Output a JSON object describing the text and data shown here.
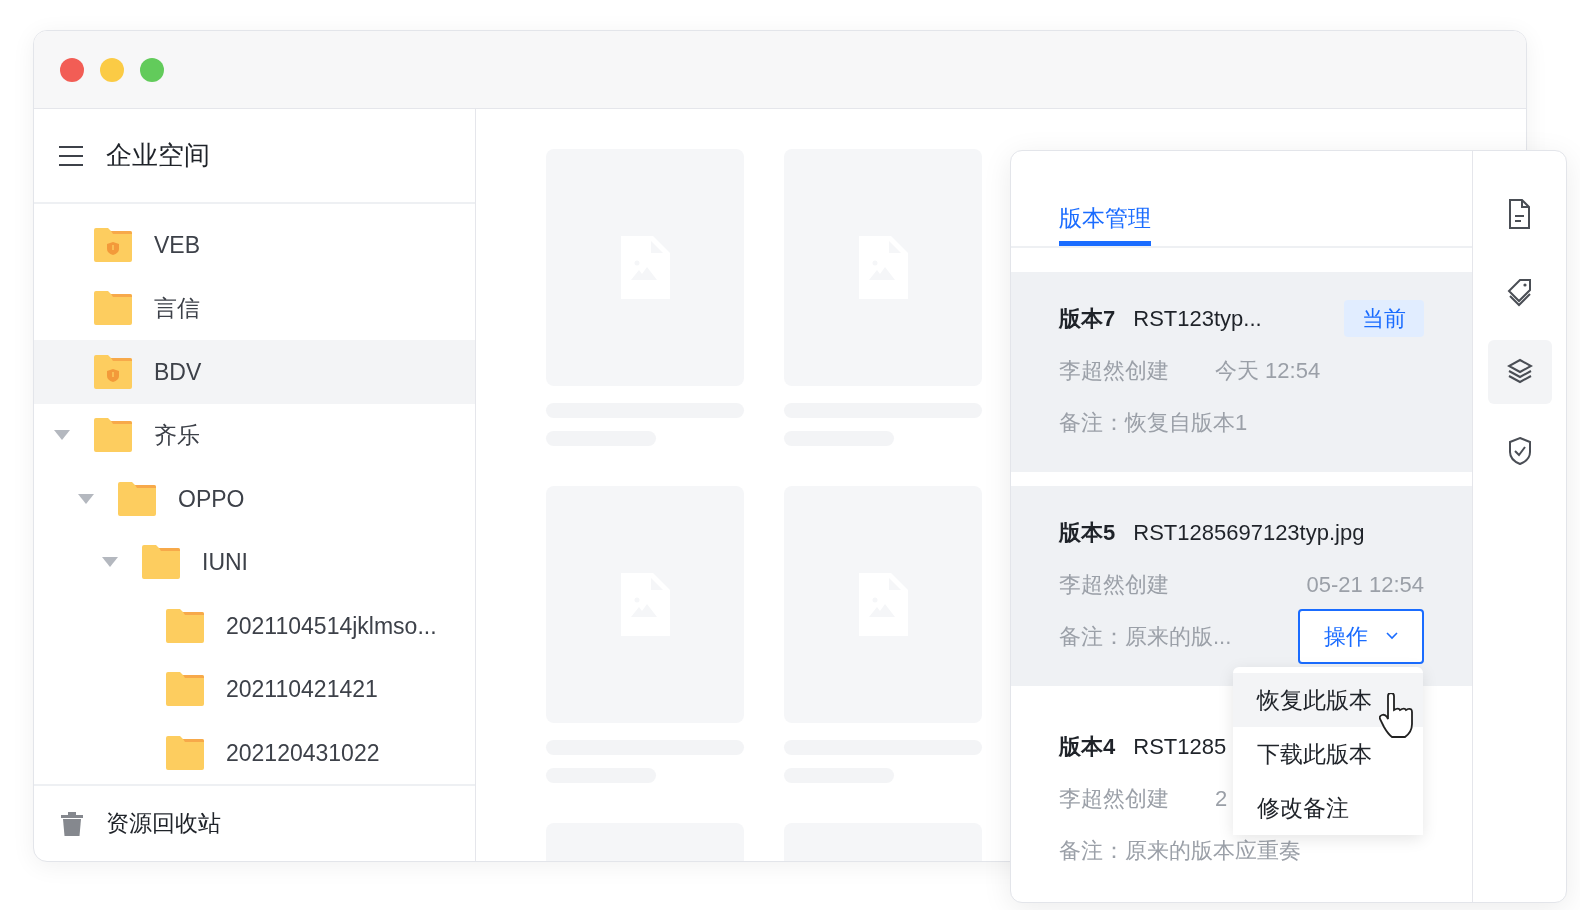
{
  "window": {
    "traffic_lights": [
      {
        "color": "#f25d55"
      },
      {
        "color": "#fbcb45"
      },
      {
        "color": "#62cb5b"
      }
    ]
  },
  "sidebar": {
    "title": "企业空间",
    "tree": [
      {
        "label": "VEB",
        "locked": true,
        "selected": false
      },
      {
        "label": "言信",
        "locked": false,
        "selected": false
      },
      {
        "label": "BDV",
        "locked": true,
        "selected": true
      },
      {
        "label": "齐乐",
        "locked": false,
        "selected": false,
        "expanded": true,
        "children": [
          {
            "label": "OPPO",
            "locked": false,
            "selected": false,
            "expanded": true,
            "children": [
              {
                "label": "IUNI",
                "locked": false,
                "selected": false,
                "expanded": true,
                "children": [
                  {
                    "label": "2021104514jklmso...",
                    "locked": false,
                    "selected": false
                  },
                  {
                    "label": "202110421421",
                    "locked": false,
                    "selected": false
                  },
                  {
                    "label": "202120431022",
                    "locked": false,
                    "selected": false
                  }
                ]
              }
            ]
          }
        ]
      }
    ],
    "footer": "资源回收站"
  },
  "version_panel": {
    "tab": {
      "label": "版本管理",
      "selected": true
    },
    "versions": [
      {
        "name": "版本7",
        "file": "RST123typ...",
        "badge": "当前",
        "creator": "李超然创建",
        "time": "今天 12:54",
        "note": "备注：恢复自版本1",
        "highlighted": true
      },
      {
        "name": "版本5",
        "file": "RST1285697123typ.jpg",
        "creator": "李超然创建",
        "time": "05-21 12:54",
        "note": "备注：原来的版...",
        "highlighted": true,
        "action": {
          "label": "操作",
          "expanded": true,
          "menu": [
            {
              "label": "恢复此版本",
              "hovered": true
            },
            {
              "label": "下载此版本",
              "hovered": false
            },
            {
              "label": "修改备注",
              "hovered": false
            }
          ]
        }
      },
      {
        "name": "版本4",
        "file": "RST1285",
        "creator": "李超然创建",
        "time": "2",
        "note": "备注：原来的版本应重奏",
        "highlighted": false
      }
    ],
    "rail": [
      {
        "kind": "document",
        "selected": false
      },
      {
        "kind": "tag",
        "selected": false
      },
      {
        "kind": "layers",
        "selected": true
      },
      {
        "kind": "shield",
        "selected": false
      }
    ]
  }
}
